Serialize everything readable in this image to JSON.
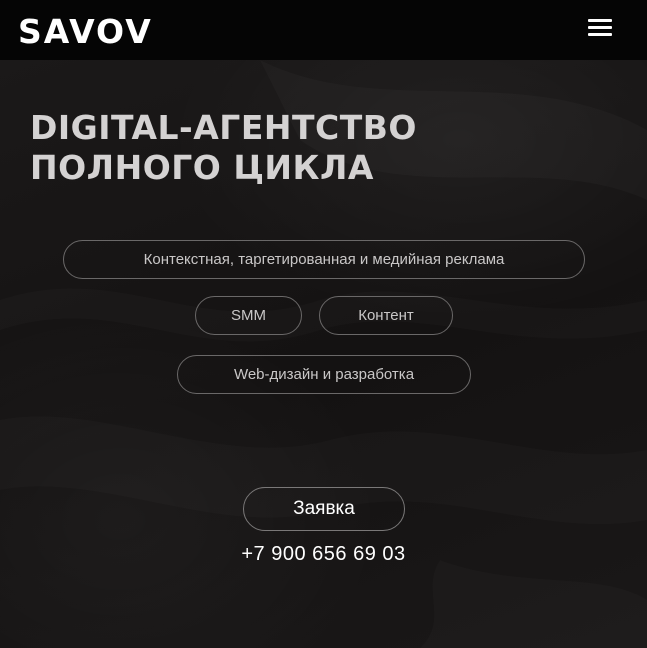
{
  "header": {
    "logo": "SAVOV",
    "menu_icon": "hamburger-menu-icon"
  },
  "hero": {
    "title_line1": "DIGITAL-АГЕНТСТВО",
    "title_line2": "ПОЛНОГО ЦИКЛА"
  },
  "services": [
    {
      "label": "Контекстная, таргетированная и медийная реклама"
    },
    {
      "label": "SMM"
    },
    {
      "label": "Контент"
    },
    {
      "label": "Web-дизайн и разработка"
    }
  ],
  "cta": {
    "label": "Заявка"
  },
  "contact": {
    "phone": "+7 900 656 69 03"
  },
  "colors": {
    "background": "#181616",
    "header": "#050505",
    "text": "#ffffff",
    "pill_border": "#6a6868"
  }
}
